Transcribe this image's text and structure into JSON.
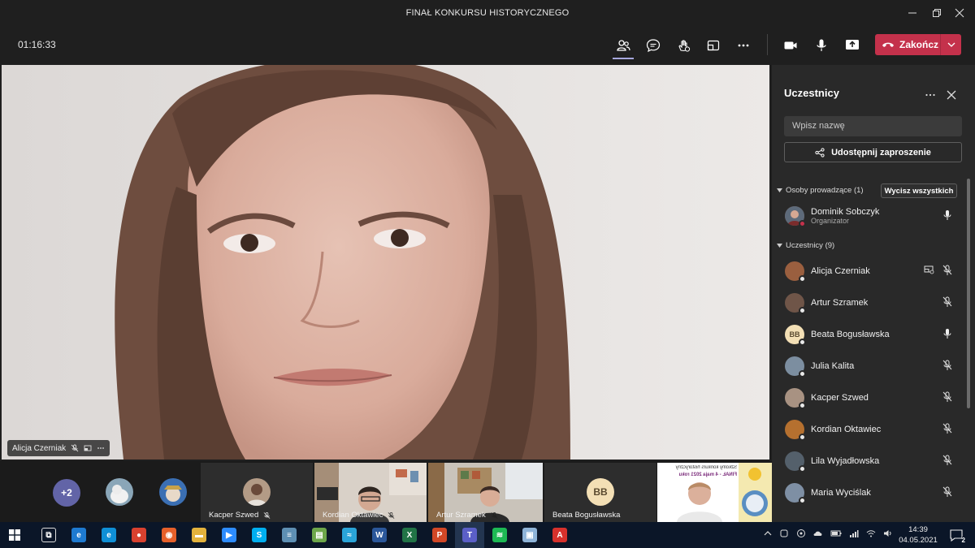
{
  "window": {
    "title": "FINAŁ KONKURSU HISTORYCZNEGO"
  },
  "call": {
    "timer": "01:16:33",
    "hangup_label": "Zakończ",
    "main_speaker": "Alicja Czerniak"
  },
  "panel": {
    "title": "Uczestnicy",
    "search_placeholder": "Wpisz nazwę",
    "invite_label": "Udostępnij zaproszenie",
    "presenters_header": "Osoby prowadzące (1)",
    "mute_all_label": "Wycisz wszystkich",
    "presenters": [
      {
        "name": "Dominik Sobczyk",
        "role": "Organizator",
        "mic": "on",
        "status": "busy"
      }
    ],
    "attendees_header": "Uczestnicy (9)",
    "attendees": [
      {
        "name": "Alicja Czerniak",
        "mic": "muted",
        "sharing": true
      },
      {
        "name": "Artur Szramek",
        "mic": "muted"
      },
      {
        "name": "Beata Bogusławska",
        "initials": "BB",
        "mic": "on"
      },
      {
        "name": "Julia Kalita",
        "mic": "muted"
      },
      {
        "name": "Kacper Szwed",
        "mic": "muted"
      },
      {
        "name": "Kordian Oktawiec",
        "mic": "muted"
      },
      {
        "name": "Lila Wyjadłowska",
        "mic": "muted"
      },
      {
        "name": "Maria Wyciślak",
        "mic": "muted"
      }
    ]
  },
  "strip": {
    "more_count": "+2",
    "tiles": [
      {
        "name": "Kacper Szwed"
      },
      {
        "name": "Kordian Oktawiec"
      },
      {
        "name": "Artur Szramek"
      },
      {
        "name": "Beata Bogusławska",
        "initials": "BB"
      }
    ],
    "slide_line1": "Szkolny konkurs historyczny",
    "slide_line2": "FINAŁ - 4 maja 2021 roku"
  },
  "taskbar": {
    "time": "14:39",
    "date": "04.05.2021",
    "notification_count": "2"
  },
  "colors": {
    "accent": "#6264a7",
    "hangup": "#c4314b",
    "panel": "#292929"
  }
}
